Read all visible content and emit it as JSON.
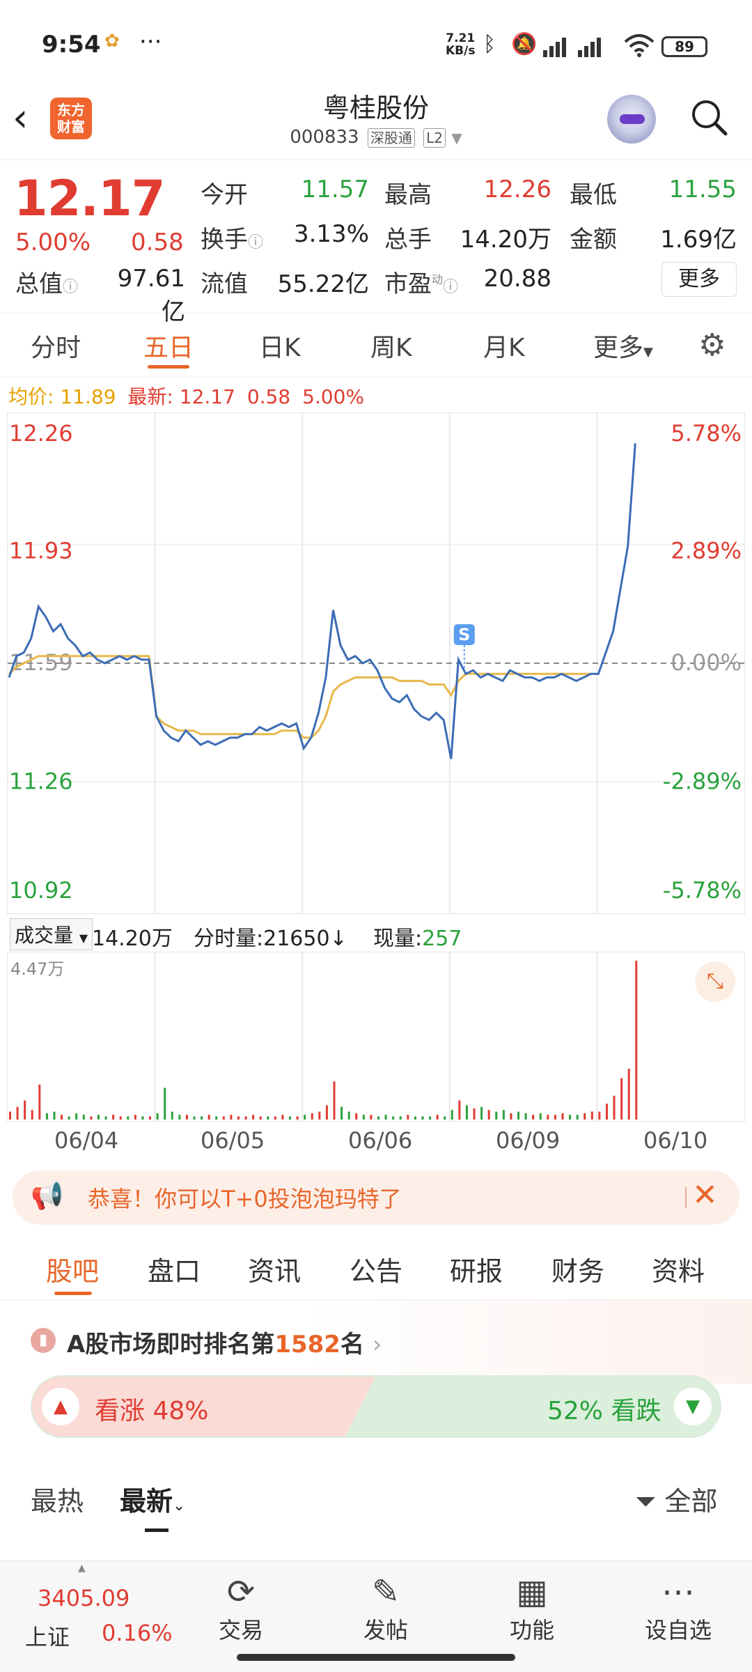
{
  "status_bar": {
    "time": "9:54",
    "net_speed_value": "7.21",
    "net_speed_unit": "KB/s",
    "battery": "89"
  },
  "header": {
    "logo_line1": "东方",
    "logo_line2": "财富",
    "stock_name": "粤桂股份",
    "stock_code": "000833",
    "tag1": "深股通",
    "tag2": "L2"
  },
  "quote": {
    "price": "12.17",
    "change_pct": "5.00%",
    "change": "0.58",
    "rows": [
      [
        {
          "label": "今开",
          "value": "11.57",
          "color": "green"
        },
        {
          "label": "最高",
          "value": "12.26",
          "color": "red"
        },
        {
          "label": "最低",
          "value": "11.55",
          "color": "green"
        }
      ],
      [
        {
          "label": "换手",
          "value": "3.13%",
          "color": "black"
        },
        {
          "label": "总手",
          "value": "14.20万",
          "color": "black"
        },
        {
          "label": "金额",
          "value": "1.69亿",
          "color": "black"
        }
      ]
    ],
    "total_value_label": "总值",
    "total_value": "97.61亿",
    "float_value_label": "流值",
    "float_value": "55.22亿",
    "pe_label": "市盈",
    "pe_sup": "动",
    "pe": "20.88",
    "more_label": "更多"
  },
  "chart_tabs": {
    "items": [
      "分时",
      "五日",
      "日K",
      "周K",
      "月K",
      "更多"
    ],
    "active_index": 1
  },
  "avg_line": {
    "avg_label": "均价:",
    "avg_value": "11.89",
    "last_label": "最新:",
    "last_value": "12.17",
    "last_change": "0.58",
    "last_pct": "5.00%"
  },
  "chart_data": {
    "type": "line",
    "y_ticks_left": [
      "12.26",
      "11.93",
      "11.59",
      "11.26",
      "10.92"
    ],
    "y_ticks_right": [
      "5.78%",
      "2.89%",
      "0.00%",
      "-2.89%",
      "-5.78%"
    ],
    "ylim": [
      10.92,
      12.26
    ],
    "prev_close": 11.59,
    "x_dates": [
      "06/04",
      "06/05",
      "06/06",
      "06/09",
      "06/10"
    ],
    "marker_label": "S",
    "series": [
      {
        "values": [
          11.55,
          11.61,
          11.62,
          11.66,
          11.75,
          11.72,
          11.68,
          11.7,
          11.66,
          11.64,
          11.61,
          11.62,
          11.6,
          11.59,
          11.6,
          11.61,
          11.6,
          11.61,
          11.6,
          11.6,
          11.44,
          11.4,
          11.38,
          11.37,
          11.4,
          11.38,
          11.36,
          11.37,
          11.36,
          11.37,
          11.38,
          11.38,
          11.39,
          11.39,
          11.41,
          11.4,
          11.41,
          11.42,
          11.41,
          11.42,
          11.35,
          11.38,
          11.45,
          11.55,
          11.74,
          11.64,
          11.6,
          11.61,
          11.59,
          11.6,
          11.57,
          11.52,
          11.49,
          11.48,
          11.5,
          11.46,
          11.44,
          11.43,
          11.45,
          11.43,
          11.32,
          11.6,
          11.56,
          11.57,
          11.55,
          11.56,
          11.55,
          11.54,
          11.57,
          11.56,
          11.55,
          11.55,
          11.54,
          11.55,
          11.55,
          11.56,
          11.55,
          11.54,
          11.55,
          11.56,
          11.56,
          11.62,
          11.68,
          11.8,
          11.92,
          12.21
        ]
      },
      {
        "values": [
          11.56,
          11.58,
          11.59,
          11.6,
          11.61,
          11.61,
          11.61,
          11.61,
          11.61,
          11.61,
          11.61,
          11.61,
          11.61,
          11.61,
          11.61,
          11.61,
          11.61,
          11.61,
          11.61,
          11.61,
          11.44,
          11.42,
          11.41,
          11.4,
          11.4,
          11.4,
          11.39,
          11.39,
          11.39,
          11.39,
          11.39,
          11.39,
          11.39,
          11.39,
          11.39,
          11.39,
          11.39,
          11.4,
          11.4,
          11.4,
          11.38,
          11.38,
          11.4,
          11.44,
          11.51,
          11.53,
          11.54,
          11.55,
          11.55,
          11.55,
          11.55,
          11.55,
          11.55,
          11.54,
          11.54,
          11.54,
          11.54,
          11.53,
          11.53,
          11.53,
          11.5,
          11.54,
          11.56,
          11.56,
          11.56,
          11.56,
          11.56,
          11.56,
          11.56,
          11.56,
          11.56,
          11.56,
          11.56,
          11.56,
          11.56,
          11.56,
          11.56,
          11.56,
          11.56,
          11.56
        ]
      }
    ]
  },
  "volume": {
    "selector_label": "成交量",
    "total": "14.20万",
    "minute_label": "分时量:",
    "minute_value": "21650",
    "current_label": "现量:",
    "current_value": "257",
    "max_label": "4.47万",
    "bars": [
      0.05,
      0.08,
      0.12,
      0.06,
      0.22,
      0.04,
      0.05,
      0.03,
      0.02,
      0.04,
      0.03,
      0.02,
      0.03,
      0.02,
      0.03,
      0.02,
      0.02,
      0.03,
      0.02,
      0.02,
      0.04,
      0.2,
      0.05,
      0.03,
      0.03,
      0.02,
      0.02,
      0.03,
      0.02,
      0.02,
      0.03,
      0.02,
      0.02,
      0.03,
      0.02,
      0.02,
      0.02,
      0.03,
      0.02,
      0.02,
      0.03,
      0.04,
      0.05,
      0.09,
      0.24,
      0.08,
      0.05,
      0.04,
      0.03,
      0.03,
      0.02,
      0.03,
      0.02,
      0.02,
      0.03,
      0.02,
      0.02,
      0.02,
      0.03,
      0.02,
      0.06,
      0.12,
      0.09,
      0.07,
      0.08,
      0.06,
      0.05,
      0.06,
      0.04,
      0.05,
      0.04,
      0.03,
      0.04,
      0.03,
      0.03,
      0.04,
      0.03,
      0.03,
      0.04,
      0.05,
      0.05,
      0.1,
      0.15,
      0.26,
      0.32,
      1.0
    ]
  },
  "banner": {
    "text": "恭喜！你可以T+0投泡泡玛特了"
  },
  "sub_tabs": {
    "items": [
      "股吧",
      "盘口",
      "资讯",
      "公告",
      "研报",
      "财务",
      "资料"
    ],
    "active_index": 0
  },
  "rank": {
    "prefix": "A股市场即时排名第",
    "number": "1582",
    "suffix": "名"
  },
  "vote": {
    "up_label": "看涨 48%",
    "down_label": "52% 看跌",
    "up_fraction": 0.48
  },
  "filters": {
    "hot": "最热",
    "latest": "最新",
    "all": "全部"
  },
  "bottom_nav": {
    "index_value": "3405.09",
    "index_name": "上证",
    "index_pct": "0.16%",
    "items": [
      "交易",
      "发帖",
      "功能",
      "设自选"
    ]
  },
  "colors": {
    "up": "#e03c31",
    "down": "#2aa23c",
    "accent": "#e8662a",
    "price_line": "#3b6cb5",
    "avg_line": "#e8b84a"
  }
}
